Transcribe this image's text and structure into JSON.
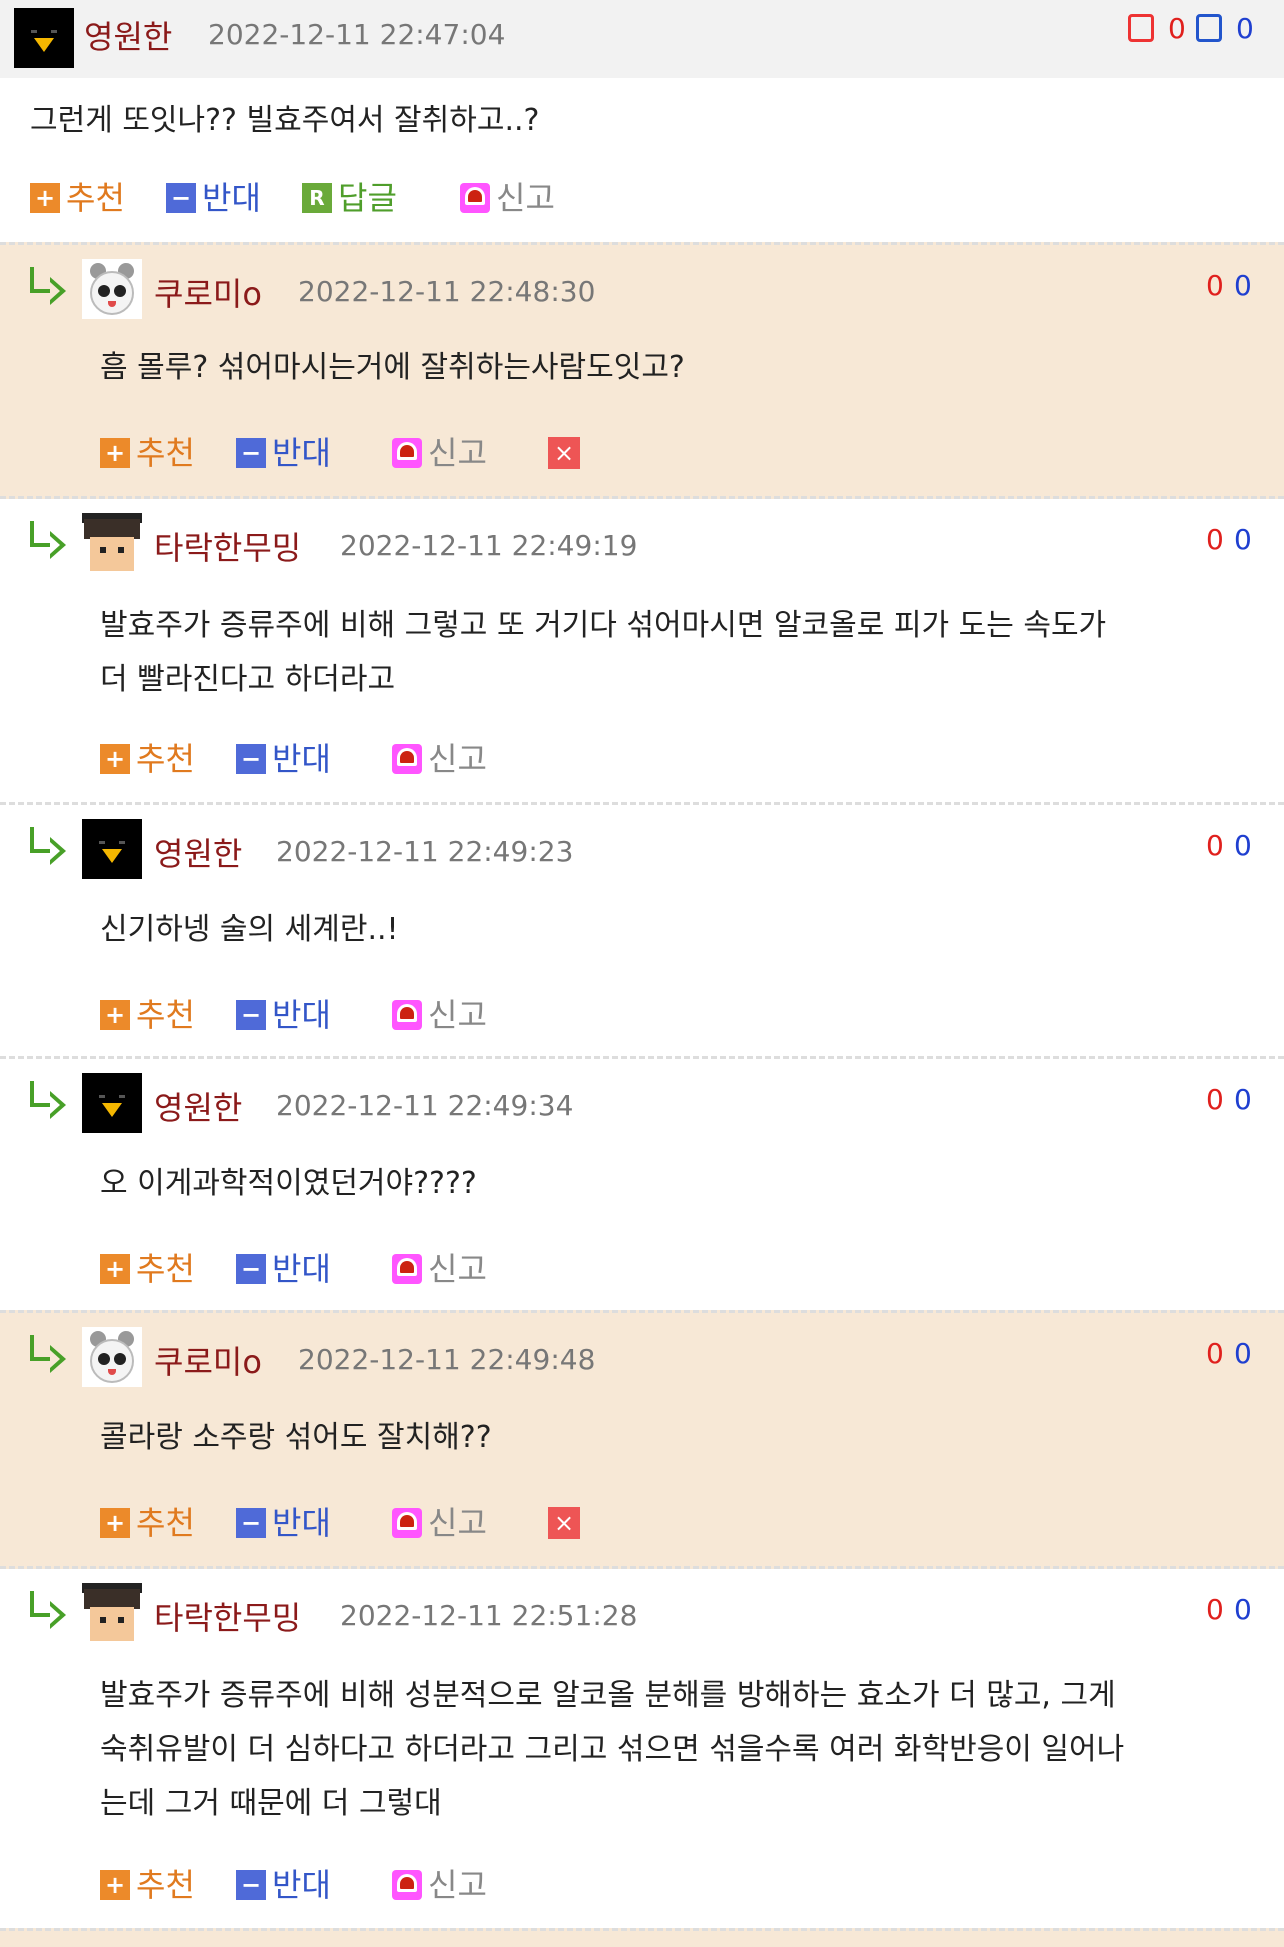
{
  "top": {
    "nick": "영원한",
    "date": "2022-12-11 22:47:04",
    "up": "0",
    "down": "0",
    "text": "그런게 또잇나?? 빌효주여서 잘취하고..?",
    "actions": {
      "recommend": "추천",
      "oppose": "반대",
      "reply": "답글",
      "report": "신고"
    }
  },
  "labels": {
    "recommend": "추천",
    "oppose": "반대",
    "report": "신고",
    "delete": "×"
  },
  "replies": [
    {
      "nick": "쿠로미o",
      "date": "2022-12-11 22:48:30",
      "up": "0",
      "down": "0",
      "lines": [
        "흠 몰루? 섞어마시는거에 잘취하는사람도잇고?"
      ]
    },
    {
      "nick": "타락한무밍",
      "date": "2022-12-11 22:49:19",
      "up": "0",
      "down": "0",
      "lines": [
        "발효주가 증류주에 비해 그렇고 또 거기다 섞어마시면 알코올로 피가 도는 속도가",
        "더 빨라진다고 하더라고"
      ]
    },
    {
      "nick": "영원한",
      "date": "2022-12-11 22:49:23",
      "up": "0",
      "down": "0",
      "lines": [
        "신기하넹 술의 세계란..!"
      ]
    },
    {
      "nick": "영원한",
      "date": "2022-12-11 22:49:34",
      "up": "0",
      "down": "0",
      "lines": [
        "오 이게과학적이였던거야????"
      ]
    },
    {
      "nick": "쿠로미o",
      "date": "2022-12-11 22:49:48",
      "up": "0",
      "down": "0",
      "lines": [
        "콜라랑 소주랑 섞어도 잘치해??"
      ]
    },
    {
      "nick": "타락한무밍",
      "date": "2022-12-11 22:51:28",
      "up": "0",
      "down": "0",
      "lines": [
        "발효주가 증류주에 비해 성분적으로 알코올 분해를 방해하는 효소가 더 많고, 그게",
        "숙취유발이 더 심하다고 하더라고 그리고 섞으면 섞을수록 여러 화학반응이 일어나",
        "는데 그거 때문에 더 그렇대"
      ]
    }
  ]
}
